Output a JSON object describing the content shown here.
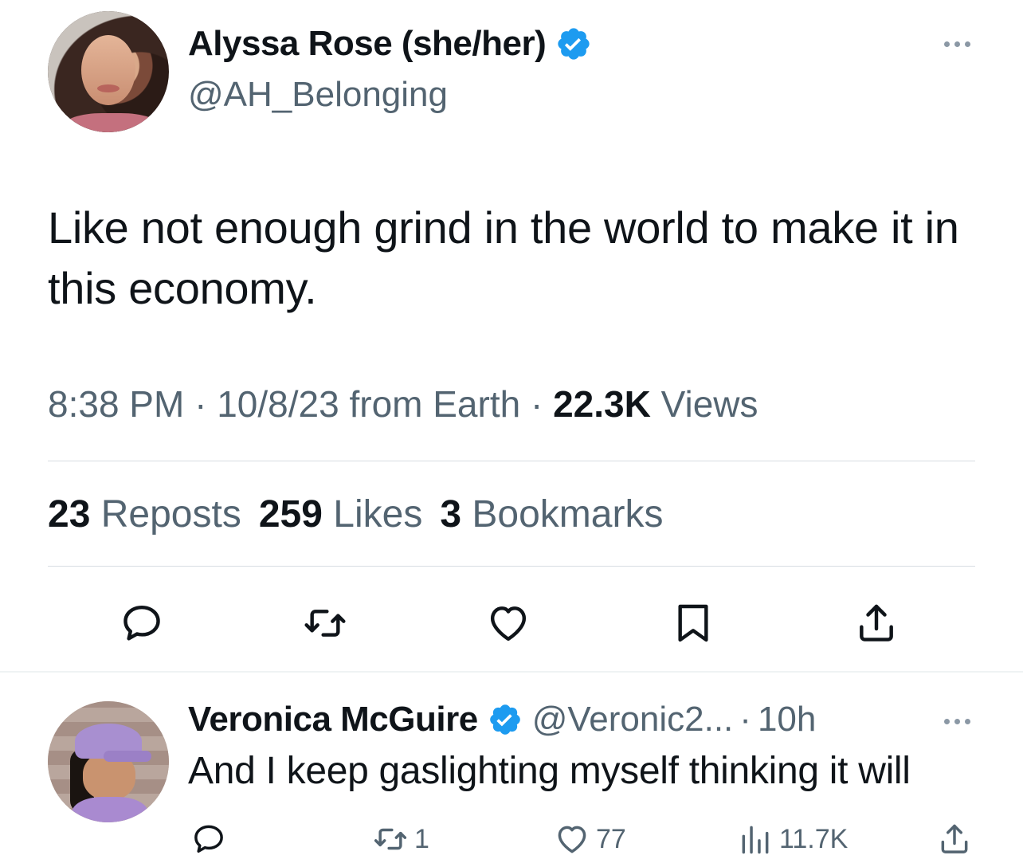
{
  "tweet": {
    "author_name": "Alyssa Rose (she/her)",
    "author_handle": "@AH_Belonging",
    "text": "Like not enough grind in the world to make it in this economy.",
    "time": "8:38 PM",
    "date": "10/8/23",
    "source": "from Earth",
    "views_count": "22.3K",
    "views_label": "Views",
    "reposts_count": "23",
    "reposts_label": "Reposts",
    "likes_count": "259",
    "likes_label": "Likes",
    "bookmarks_count": "3",
    "bookmarks_label": "Bookmarks"
  },
  "reply": {
    "author_name": "Veronica McGuire",
    "author_handle": "@Veronic2...",
    "time": "10h",
    "text": "And I keep gaslighting myself thinking it will",
    "reposts_count": "1",
    "likes_count": "77",
    "views_count": "11.7K"
  },
  "colors": {
    "verified_blue": "#1d9bf0",
    "secondary_text": "#536471",
    "primary_text": "#0f1419",
    "divider": "#d7dde2"
  },
  "icons": {
    "reply": "reply-icon",
    "repost": "repost-icon",
    "like": "heart-icon",
    "bookmark": "bookmark-icon",
    "share": "share-icon",
    "views": "views-icon",
    "verified": "verified-badge-icon",
    "more": "more-icon"
  }
}
